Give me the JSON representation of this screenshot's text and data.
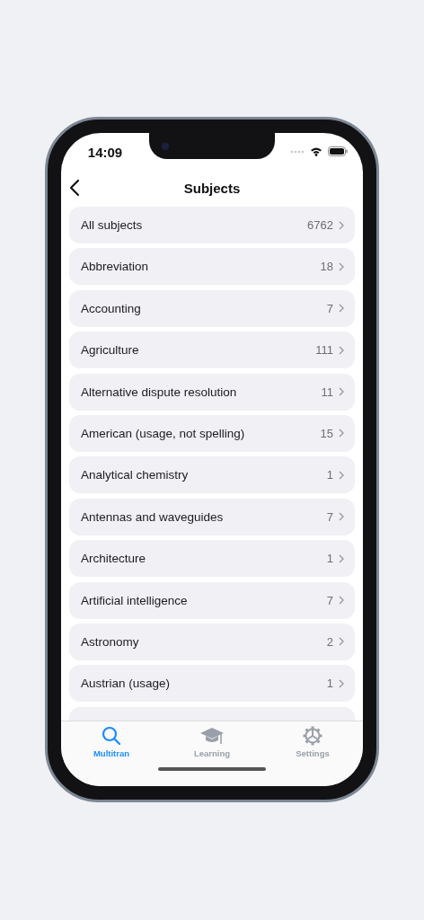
{
  "status_bar": {
    "time": "14:09"
  },
  "nav": {
    "title": "Subjects"
  },
  "subjects": [
    {
      "name": "All subjects",
      "count": "6762"
    },
    {
      "name": "Abbreviation",
      "count": "18"
    },
    {
      "name": "Accounting",
      "count": "7"
    },
    {
      "name": "Agriculture",
      "count": "111"
    },
    {
      "name": "Alternative dispute resolution",
      "count": "11"
    },
    {
      "name": "American (usage, not spelling)",
      "count": "15"
    },
    {
      "name": "Analytical chemistry",
      "count": "1"
    },
    {
      "name": "Antennas and waveguides",
      "count": "7"
    },
    {
      "name": "Architecture",
      "count": "1"
    },
    {
      "name": "Artificial intelligence",
      "count": "7"
    },
    {
      "name": "Astronomy",
      "count": "2"
    },
    {
      "name": "Austrian (usage)",
      "count": "1"
    }
  ],
  "tab_bar": [
    {
      "label": "Multitran",
      "selected": true
    },
    {
      "label": "Learning",
      "selected": false
    },
    {
      "label": "Settings",
      "selected": false
    }
  ]
}
